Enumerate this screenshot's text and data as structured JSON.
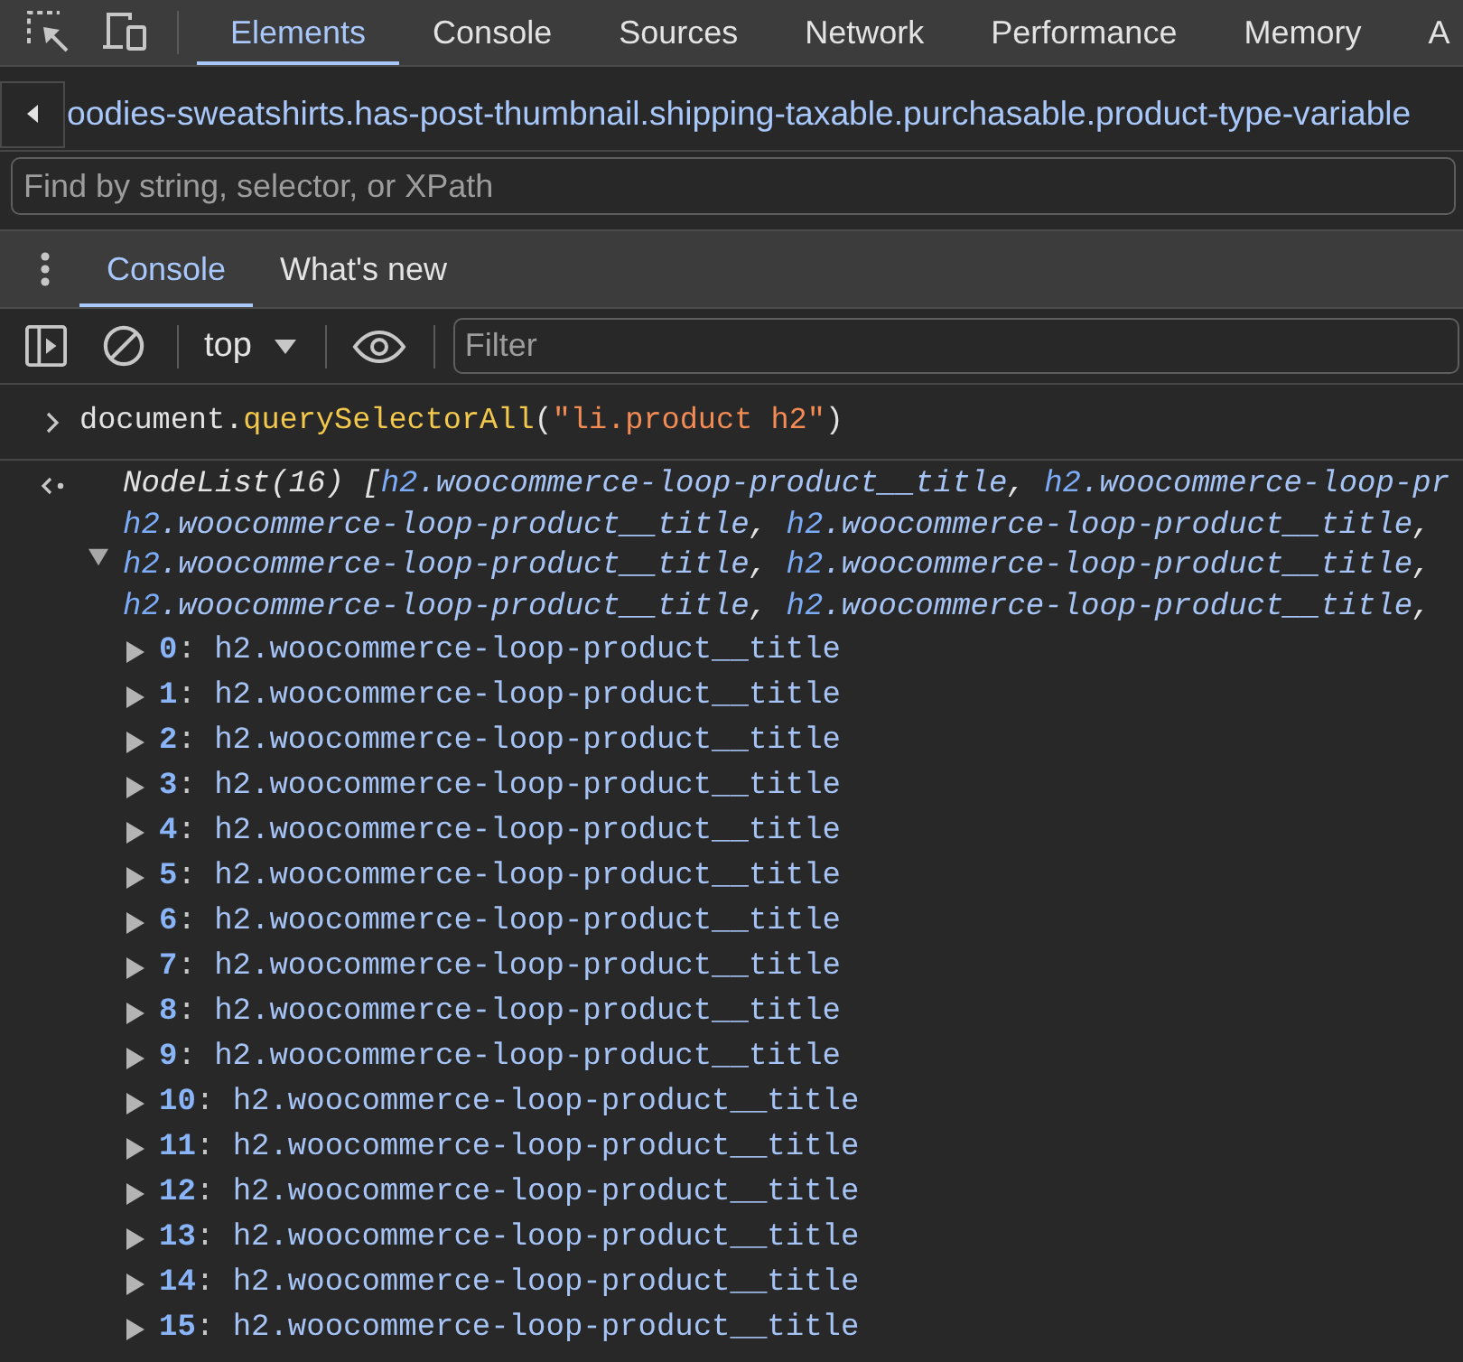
{
  "main_tabs": [
    {
      "label": "Elements",
      "selected": true
    },
    {
      "label": "Console",
      "selected": false
    },
    {
      "label": "Sources",
      "selected": false
    },
    {
      "label": "Network",
      "selected": false
    },
    {
      "label": "Performance",
      "selected": false
    },
    {
      "label": "Memory",
      "selected": false
    },
    {
      "label": "A",
      "selected": false
    }
  ],
  "breadcrumb": {
    "text": "oodies-sweatshirts.has-post-thumbnail.shipping-taxable.purchasable.product-type-variable"
  },
  "elements_search": {
    "placeholder": "Find by string, selector, or XPath"
  },
  "drawer_tabs": [
    {
      "label": "Console",
      "selected": true
    },
    {
      "label": "What's new",
      "selected": false
    }
  ],
  "console_toolbar": {
    "context": "top",
    "filter": {
      "placeholder": "Filter"
    }
  },
  "console": {
    "input": [
      {
        "kind": "plain",
        "text": "document."
      },
      {
        "kind": "method",
        "text": "querySelectorAll"
      },
      {
        "kind": "plain",
        "text": "("
      },
      {
        "kind": "string",
        "text": "\"li.product h2\""
      },
      {
        "kind": "plain",
        "text": ")"
      }
    ],
    "result": {
      "expanded": true,
      "summary_lines": [
        {
          "tokens": [
            {
              "kind": "plain",
              "text": "NodeList(16) ["
            },
            {
              "kind": "tag",
              "text": "h2"
            },
            {
              "kind": "class",
              "text": ".woocommerce-loop-product__title"
            },
            {
              "kind": "plain",
              "text": ", "
            },
            {
              "kind": "tag",
              "text": "h2"
            },
            {
              "kind": "class",
              "text": ".woocommerce-loop-pr"
            }
          ]
        },
        {
          "tokens": [
            {
              "kind": "tag",
              "text": "h2"
            },
            {
              "kind": "class",
              "text": ".woocommerce-loop-product__title"
            },
            {
              "kind": "plain",
              "text": ", "
            },
            {
              "kind": "tag",
              "text": "h2"
            },
            {
              "kind": "class",
              "text": ".woocommerce-loop-product__title"
            },
            {
              "kind": "plain",
              "text": ","
            }
          ]
        },
        {
          "tokens": [
            {
              "kind": "tag",
              "text": "h2"
            },
            {
              "kind": "class",
              "text": ".woocommerce-loop-product__title"
            },
            {
              "kind": "plain",
              "text": ", "
            },
            {
              "kind": "tag",
              "text": "h2"
            },
            {
              "kind": "class",
              "text": ".woocommerce-loop-product__title"
            },
            {
              "kind": "plain",
              "text": ","
            }
          ]
        },
        {
          "tokens": [
            {
              "kind": "tag",
              "text": "h2"
            },
            {
              "kind": "class",
              "text": ".woocommerce-loop-product__title"
            },
            {
              "kind": "plain",
              "text": ", "
            },
            {
              "kind": "tag",
              "text": "h2"
            },
            {
              "kind": "class",
              "text": ".woocommerce-loop-product__title"
            },
            {
              "kind": "plain",
              "text": ","
            }
          ]
        }
      ],
      "items": [
        {
          "key": "0",
          "sep": ": ",
          "value": "h2.woocommerce-loop-product__title",
          "expanded": false
        },
        {
          "key": "1",
          "sep": ": ",
          "value": "h2.woocommerce-loop-product__title",
          "expanded": false
        },
        {
          "key": "2",
          "sep": ": ",
          "value": "h2.woocommerce-loop-product__title",
          "expanded": false
        },
        {
          "key": "3",
          "sep": ": ",
          "value": "h2.woocommerce-loop-product__title",
          "expanded": false
        },
        {
          "key": "4",
          "sep": ": ",
          "value": "h2.woocommerce-loop-product__title",
          "expanded": false
        },
        {
          "key": "5",
          "sep": ": ",
          "value": "h2.woocommerce-loop-product__title",
          "expanded": false
        },
        {
          "key": "6",
          "sep": ": ",
          "value": "h2.woocommerce-loop-product__title",
          "expanded": false
        },
        {
          "key": "7",
          "sep": ": ",
          "value": "h2.woocommerce-loop-product__title",
          "expanded": false
        },
        {
          "key": "8",
          "sep": ": ",
          "value": "h2.woocommerce-loop-product__title",
          "expanded": false
        },
        {
          "key": "9",
          "sep": ": ",
          "value": "h2.woocommerce-loop-product__title",
          "expanded": false
        },
        {
          "key": "10",
          "sep": ": ",
          "value": "h2.woocommerce-loop-product__title",
          "expanded": false
        },
        {
          "key": "11",
          "sep": ": ",
          "value": "h2.woocommerce-loop-product__title",
          "expanded": false
        },
        {
          "key": "12",
          "sep": ": ",
          "value": "h2.woocommerce-loop-product__title",
          "expanded": false
        },
        {
          "key": "13",
          "sep": ": ",
          "value": "h2.woocommerce-loop-product__title",
          "expanded": false
        },
        {
          "key": "14",
          "sep": ": ",
          "value": "h2.woocommerce-loop-product__title",
          "expanded": false
        },
        {
          "key": "15",
          "sep": ": ",
          "value": "h2.woocommerce-loop-product__title",
          "expanded": false
        }
      ]
    }
  }
}
